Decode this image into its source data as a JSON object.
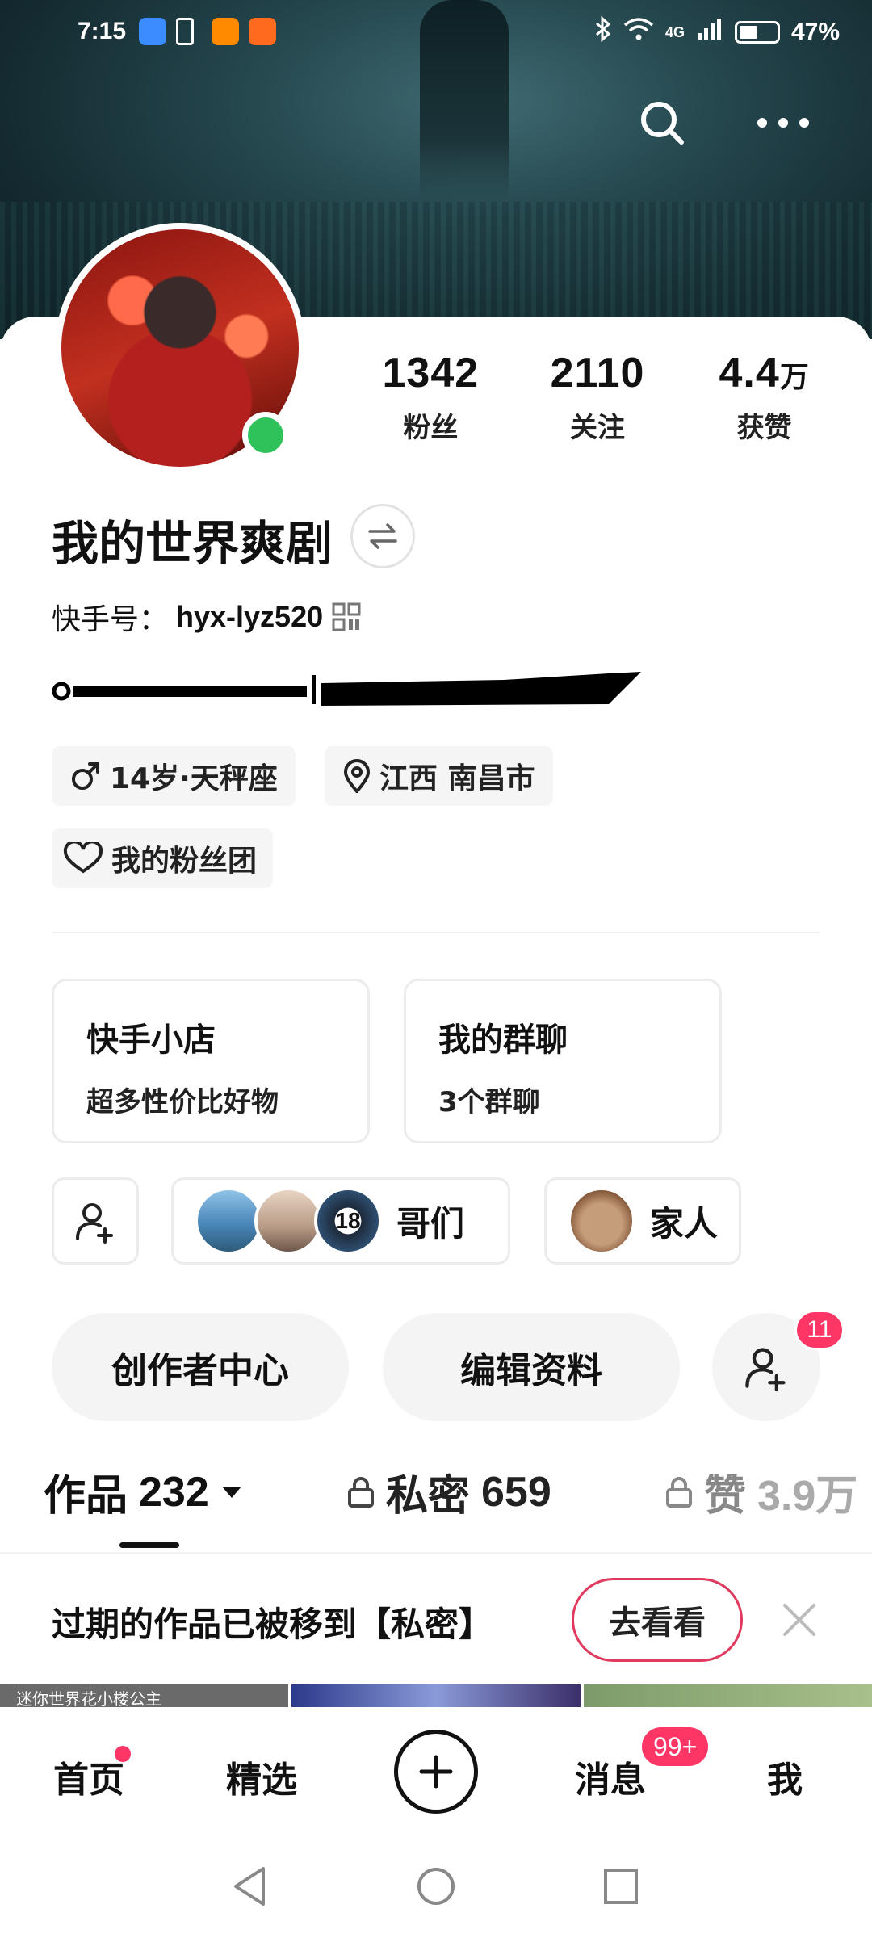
{
  "status_bar": {
    "time": "7:15",
    "network": "4G",
    "battery": "47%"
  },
  "profile": {
    "name": "我的世界爽剧",
    "kuaishou_id_label": "快手号：",
    "kuaishou_id": "hyx-lyz520",
    "stats": [
      {
        "value": "1342",
        "unit": "",
        "label": "粉丝"
      },
      {
        "value": "2110",
        "unit": "",
        "label": "关注"
      },
      {
        "value": "4.4",
        "unit": "万",
        "label": "获赞"
      }
    ],
    "tags": {
      "age_sign": "14岁·天秤座",
      "location": "江西 南昌市",
      "fan_group": "我的粉丝团"
    },
    "online": true
  },
  "cards": [
    {
      "title": "快手小店",
      "subtitle": "超多性价比好物"
    },
    {
      "title": "我的群聊",
      "subtitle": "3个群聊"
    }
  ],
  "groups": [
    {
      "label": "哥们",
      "avatar_badge": "18"
    },
    {
      "label": "家人"
    }
  ],
  "actions": {
    "creator_center": "创作者中心",
    "edit_profile": "编辑资料",
    "add_friend_badge": "11"
  },
  "tabs": [
    {
      "label": "作品",
      "count": "232"
    },
    {
      "label": "私密",
      "count": "659"
    },
    {
      "label": "赞",
      "count": "3.9万"
    }
  ],
  "banner": {
    "message": "过期的作品已被移到【私密】",
    "button": "去看看"
  },
  "thumb_captions": [
    "迷你世界花小楼公主"
  ],
  "bottom_nav": {
    "home": "首页",
    "featured": "精选",
    "messages": "消息",
    "messages_badge": "99+",
    "me": "我"
  },
  "colors": {
    "accent": "#fe3666",
    "online": "#2fc25a",
    "cover": "#25474e"
  }
}
